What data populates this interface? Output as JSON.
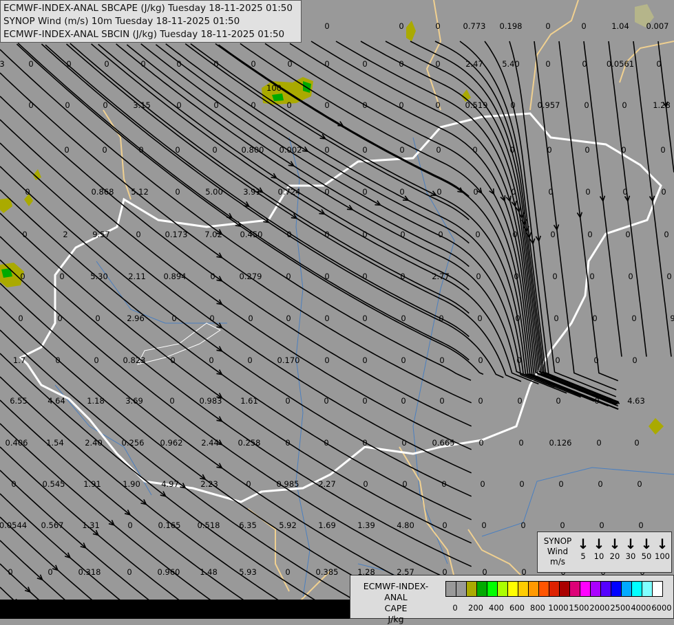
{
  "header": {
    "lines": [
      "ECMWF-INDEX-ANAL SBCAPE (J/kg) Tuesday 18-11-2025 01:50",
      "SYNOP Wind (m/s) 10m Tuesday 18-11-2025 01:50",
      "ECMWF-INDEX-ANAL SBCIN (J/kg) Tuesday 18-11-2025 01:50"
    ]
  },
  "synop_legend": {
    "title_lines": [
      "SYNOP",
      "Wind",
      "m/s"
    ],
    "arrow_icon": "down-arrow",
    "speeds": [
      "5",
      "10",
      "20",
      "30",
      "50",
      "100"
    ]
  },
  "cape_legend": {
    "title_lines": [
      "ECMWF-INDEX-ANAL",
      "CAPE",
      "J/kg"
    ],
    "colors": [
      "#999999",
      "#999999",
      "#aaaa00",
      "#00aa00",
      "#00ff00",
      "#aaff00",
      "#ffff00",
      "#ffcc00",
      "#ff9900",
      "#ff5500",
      "#dd2200",
      "#aa0000",
      "#dd0077",
      "#ff00ff",
      "#aa00ff",
      "#5500ff",
      "#0000ff",
      "#00aaff",
      "#00ffff",
      "#80ffff",
      "#ffffff"
    ],
    "ticks": [
      "0",
      "200",
      "400",
      "600",
      "800",
      "1000",
      "1500",
      "2000",
      "2500",
      "4000",
      "6000"
    ]
  },
  "map": {
    "value_rows": [
      [
        "0",
        "0",
        "0",
        "0.773",
        "0.198",
        "0",
        "0",
        "1.04",
        "0.007"
      ],
      [
        "3",
        "0",
        "0",
        "0",
        "0",
        "0",
        "0",
        "0",
        "0",
        "0",
        "0",
        "0",
        "0",
        "2.47",
        "5.40",
        "0",
        "0",
        "0.0561",
        "0"
      ],
      [
        "100"
      ],
      [
        "0",
        "0",
        "0",
        "3.15",
        "0",
        "0",
        "0",
        "0",
        "0",
        "0",
        "0",
        "0",
        "0.519",
        "0",
        "0.957",
        "0",
        "0",
        "1.28"
      ],
      [
        "0",
        "0",
        "0",
        "0",
        "0",
        "0.800",
        "0.002",
        "0",
        "0",
        "0",
        "0",
        "0",
        "0",
        "0",
        "0",
        "0",
        "0"
      ],
      [
        "0",
        "0.868",
        "5.12",
        "0",
        "5.00",
        "3.91",
        "0.724",
        "0",
        "0",
        "0",
        "0",
        "0",
        "0",
        "0",
        "0",
        "0",
        "0"
      ],
      [
        "0",
        "2",
        "9.57",
        "0",
        "0.173",
        "7.02",
        "0.450",
        "0",
        "0",
        "0",
        "0",
        "0",
        "0",
        "0",
        "0",
        "0",
        "0",
        "0"
      ],
      [
        "0",
        "0",
        "5.30",
        "2.11",
        "0.894",
        "0",
        "0.279",
        "0",
        "0",
        "0",
        "0",
        "2.77",
        "0",
        "0",
        "0",
        "0",
        "0",
        "0"
      ],
      [
        "0",
        "0",
        "0",
        "2.96",
        "0",
        "0",
        "0",
        "0",
        "0",
        "0",
        "0",
        "0",
        "0",
        "0",
        "0",
        "0",
        "0",
        "9"
      ],
      [
        "1.7",
        "0",
        "0",
        "0.823",
        "0",
        "0",
        "0",
        "0.170",
        "0",
        "0",
        "0",
        "0",
        "0",
        "0",
        "0",
        "0",
        "0"
      ],
      [
        "6.55",
        "4.64",
        "1.18",
        "3.69",
        "0",
        "0.983",
        "1.61",
        "0",
        "0",
        "0",
        "0",
        "0",
        "0",
        "0",
        "0",
        "0",
        "4.63"
      ],
      [
        "0.406",
        "1.54",
        "2.40",
        "0.256",
        "0.962",
        "2.44",
        "0.258",
        "0",
        "0",
        "0",
        "0",
        "0.665",
        "0",
        "0",
        "0.126",
        "0",
        "0"
      ],
      [
        "0",
        "0.545",
        "1.91",
        "1.90",
        "4.97",
        "2.23",
        "0",
        "0.985",
        "2.27",
        "0",
        "0",
        "0",
        "0",
        "0",
        "0",
        "0",
        "0"
      ],
      [
        "0.0544",
        "0.567",
        "1.31",
        "0",
        "0.165",
        "0.518",
        "6.35",
        "5.92",
        "1.69",
        "1.39",
        "4.80",
        "0",
        "0",
        "0",
        "0",
        "0",
        "0"
      ],
      [
        "0",
        "0",
        "0.318",
        "0",
        "0.960",
        "1.48",
        "5.93",
        "0",
        "0.385",
        "1.28",
        "2.57",
        "0",
        "0",
        "0",
        "0",
        "0",
        "0"
      ]
    ]
  }
}
